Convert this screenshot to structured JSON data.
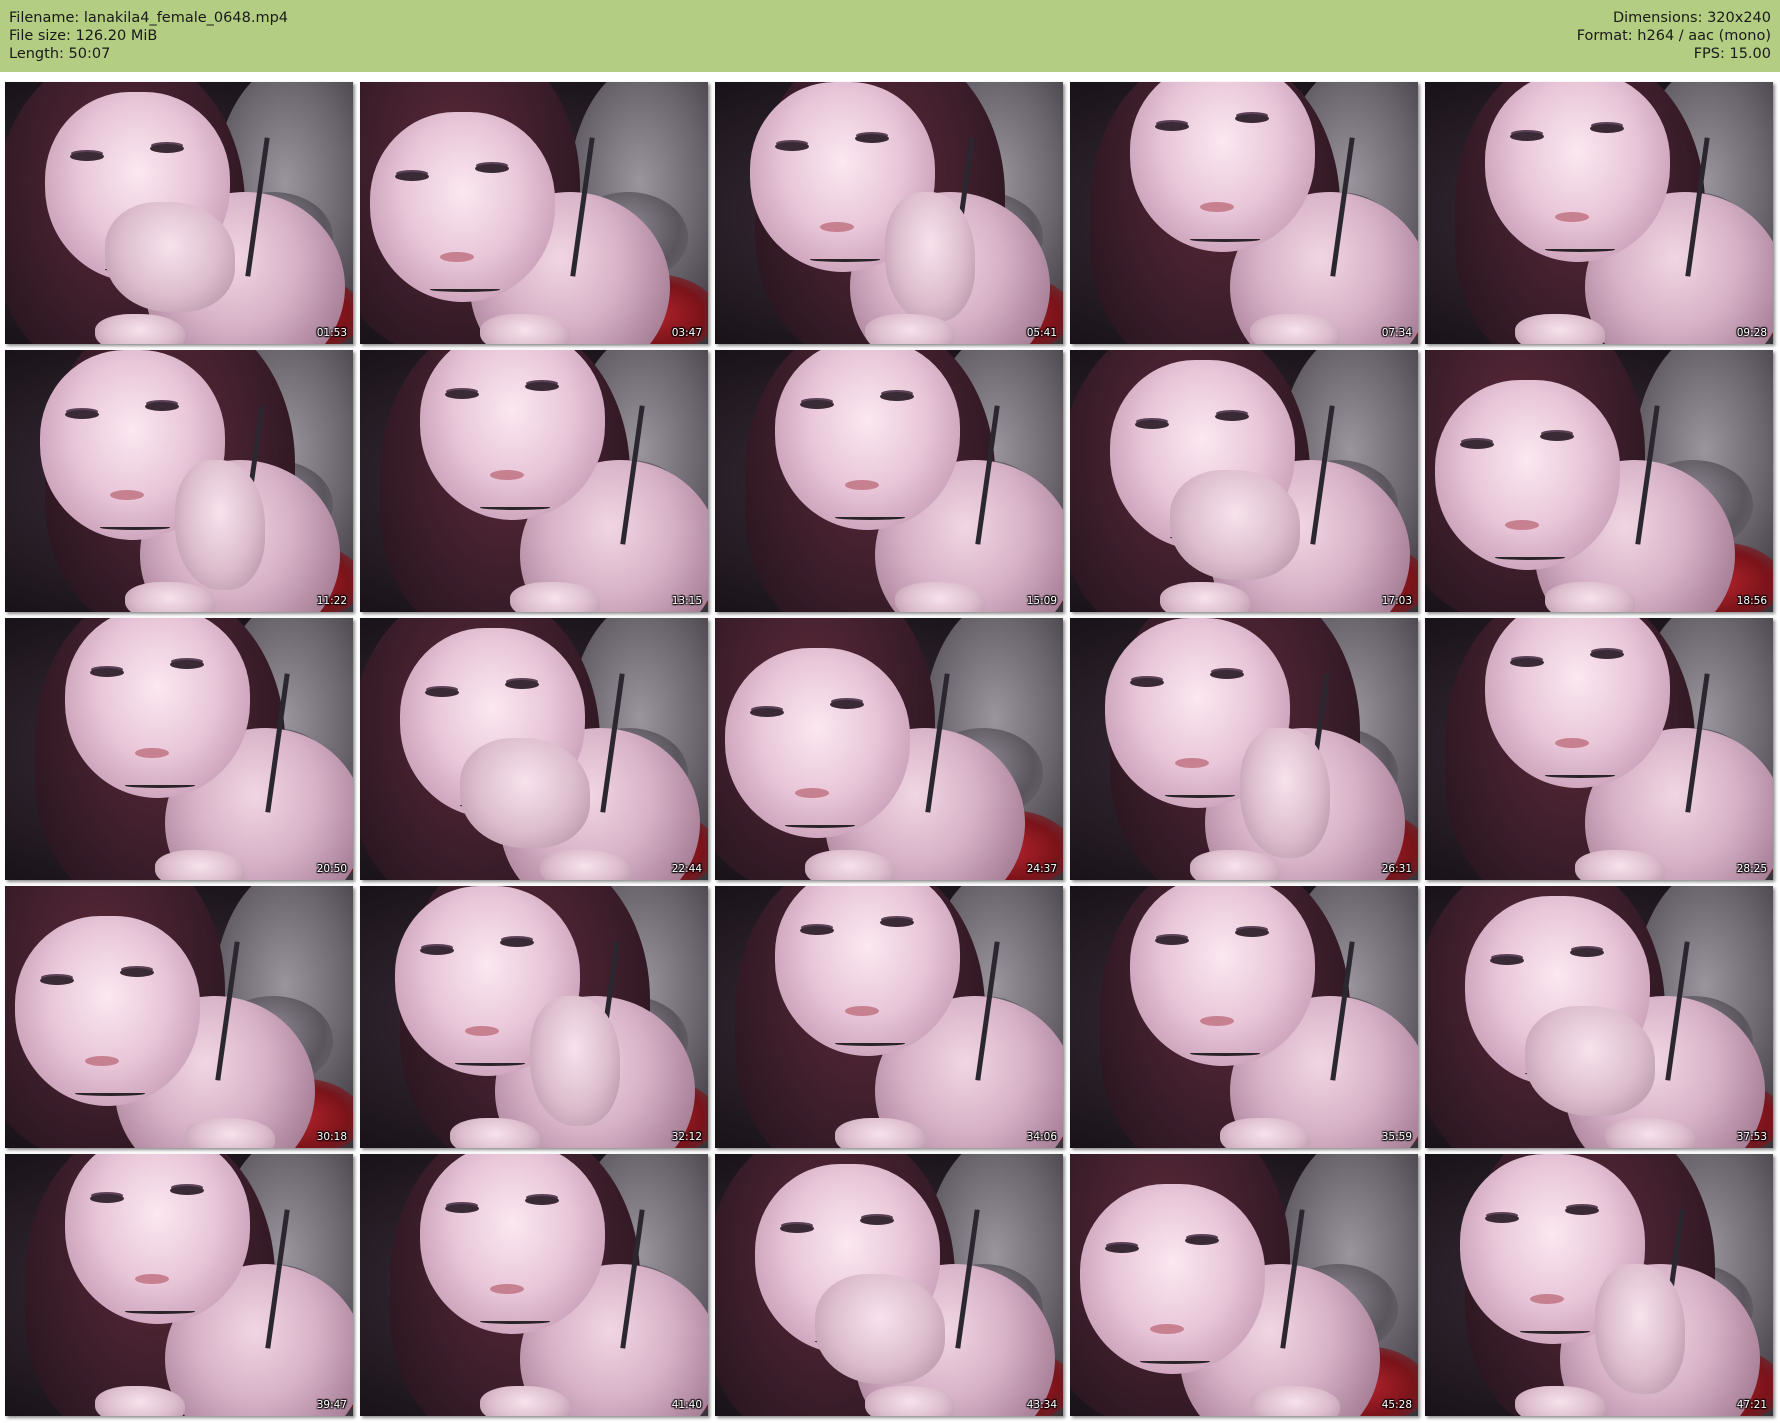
{
  "header": {
    "filename_label": "Filename:",
    "filename": "lanakila4_female_0648.mp4",
    "filesize_label": "File size:",
    "filesize": "126.20 MiB",
    "length_label": "Length:",
    "length": "50:07",
    "dimensions_label": "Dimensions:",
    "dimensions": "320x240",
    "format_label": "Format:",
    "format": "h264 / aac (mono)",
    "fps_label": "FPS:",
    "fps": "15.00",
    "background_color": "#b3cd82"
  },
  "thumbnails": [
    {
      "timestamp": "01:53"
    },
    {
      "timestamp": "03:47"
    },
    {
      "timestamp": "05:41"
    },
    {
      "timestamp": "07:34"
    },
    {
      "timestamp": "09:28"
    },
    {
      "timestamp": "11:22"
    },
    {
      "timestamp": "13:15"
    },
    {
      "timestamp": "15:09"
    },
    {
      "timestamp": "17:03"
    },
    {
      "timestamp": "18:56"
    },
    {
      "timestamp": "20:50"
    },
    {
      "timestamp": "22:44"
    },
    {
      "timestamp": "24:37"
    },
    {
      "timestamp": "26:31"
    },
    {
      "timestamp": "28:25"
    },
    {
      "timestamp": "30:18"
    },
    {
      "timestamp": "32:12"
    },
    {
      "timestamp": "34:06"
    },
    {
      "timestamp": "35:59"
    },
    {
      "timestamp": "37:53"
    },
    {
      "timestamp": "39:47"
    },
    {
      "timestamp": "41:40"
    },
    {
      "timestamp": "43:34"
    },
    {
      "timestamp": "45:28"
    },
    {
      "timestamp": "47:21"
    }
  ]
}
